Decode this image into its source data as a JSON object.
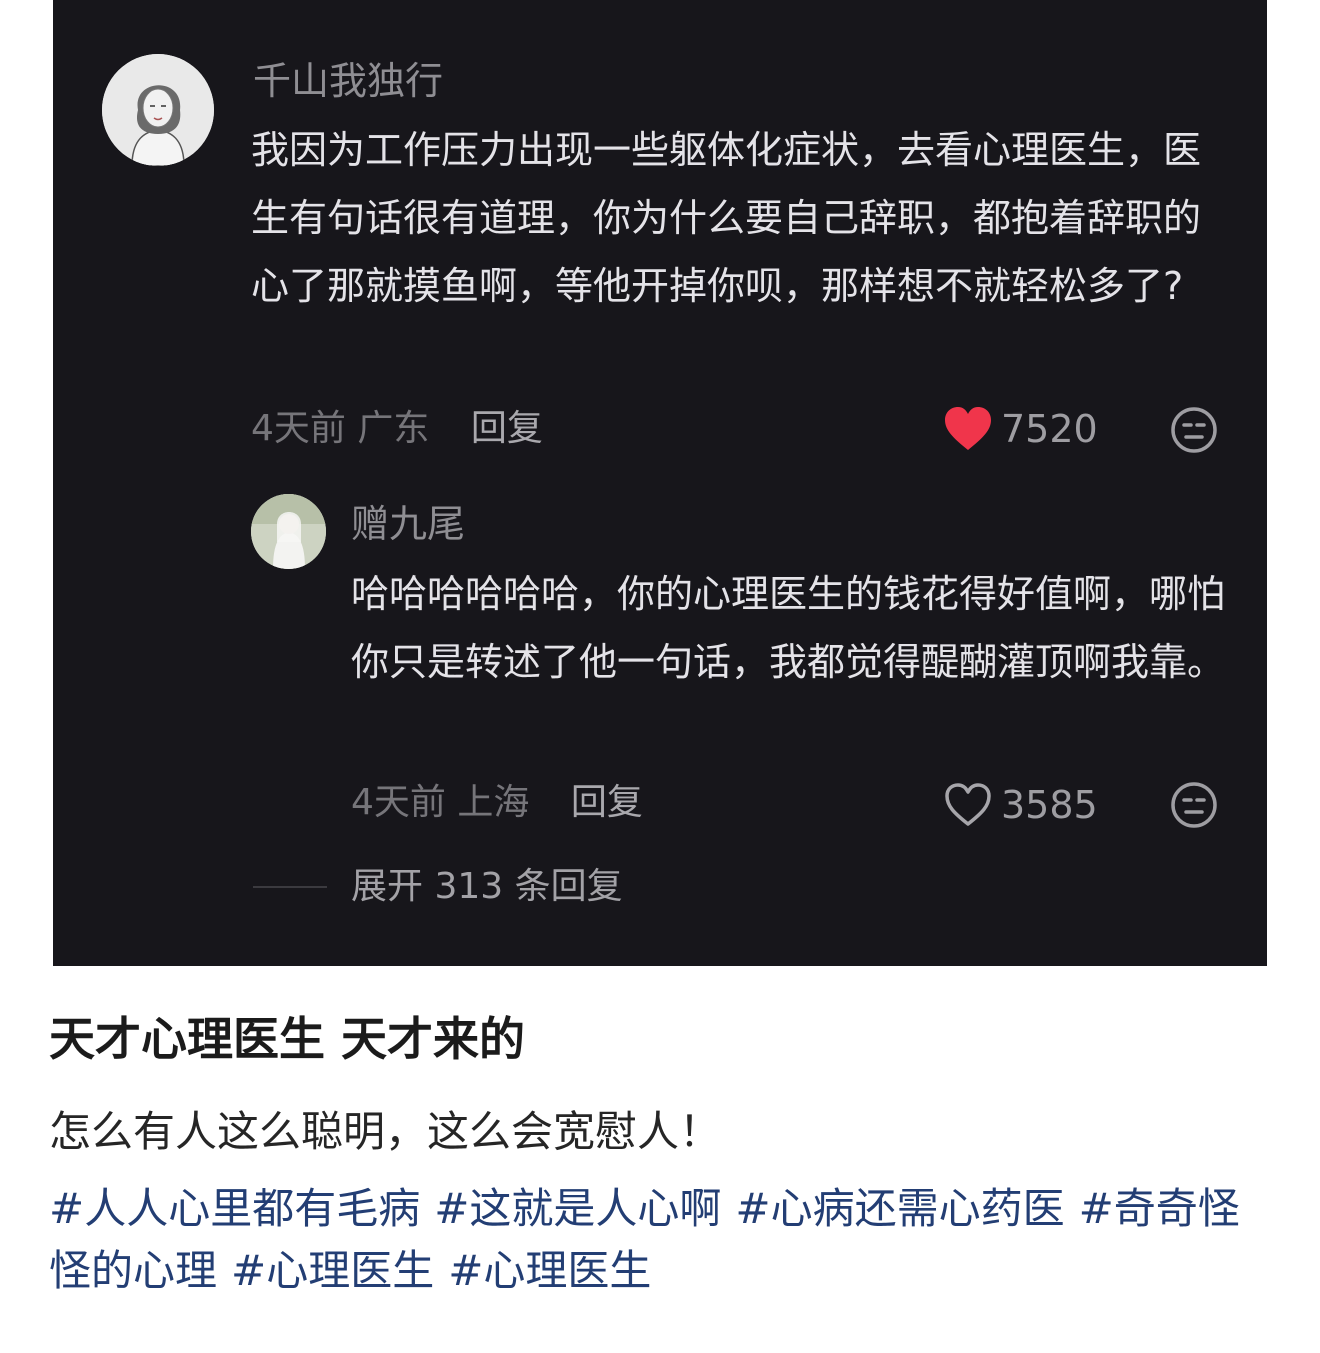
{
  "comment": {
    "username": "千山我独行",
    "text": "我因为工作压力出现一些躯体化症状，去看心理医生，医生有句话很有道理，你为什么要自己辞职，都抱着辞职的心了那就摸鱼啊，等他开掉你呗，那样想不就轻松多了?",
    "time": "4天前",
    "location": "广东",
    "reply_label": "回复",
    "likes": "7520",
    "liked": true,
    "heart_color": "#f0354b"
  },
  "reply": {
    "username": "赠九尾",
    "text": "哈哈哈哈哈哈，你的心理医生的钱花得好值啊，哪怕你只是转述了他一句话，我都觉得醍醐灌顶啊我靠。",
    "time": "4天前",
    "location": "上海",
    "reply_label": "回复",
    "likes": "3585",
    "liked": false
  },
  "expand_replies": "展开 313 条回复",
  "post": {
    "title": "天才心理医生 天才来的",
    "body": "怎么有人这么聪明，这么会宽慰人！",
    "hashtags": [
      "#人人心里都有毛病",
      "#这就是人心啊",
      "#心病还需心药医",
      "#奇奇怪怪的心理",
      "#心理医生",
      "#心理医生"
    ],
    "hashtag_color": "#233e74"
  }
}
